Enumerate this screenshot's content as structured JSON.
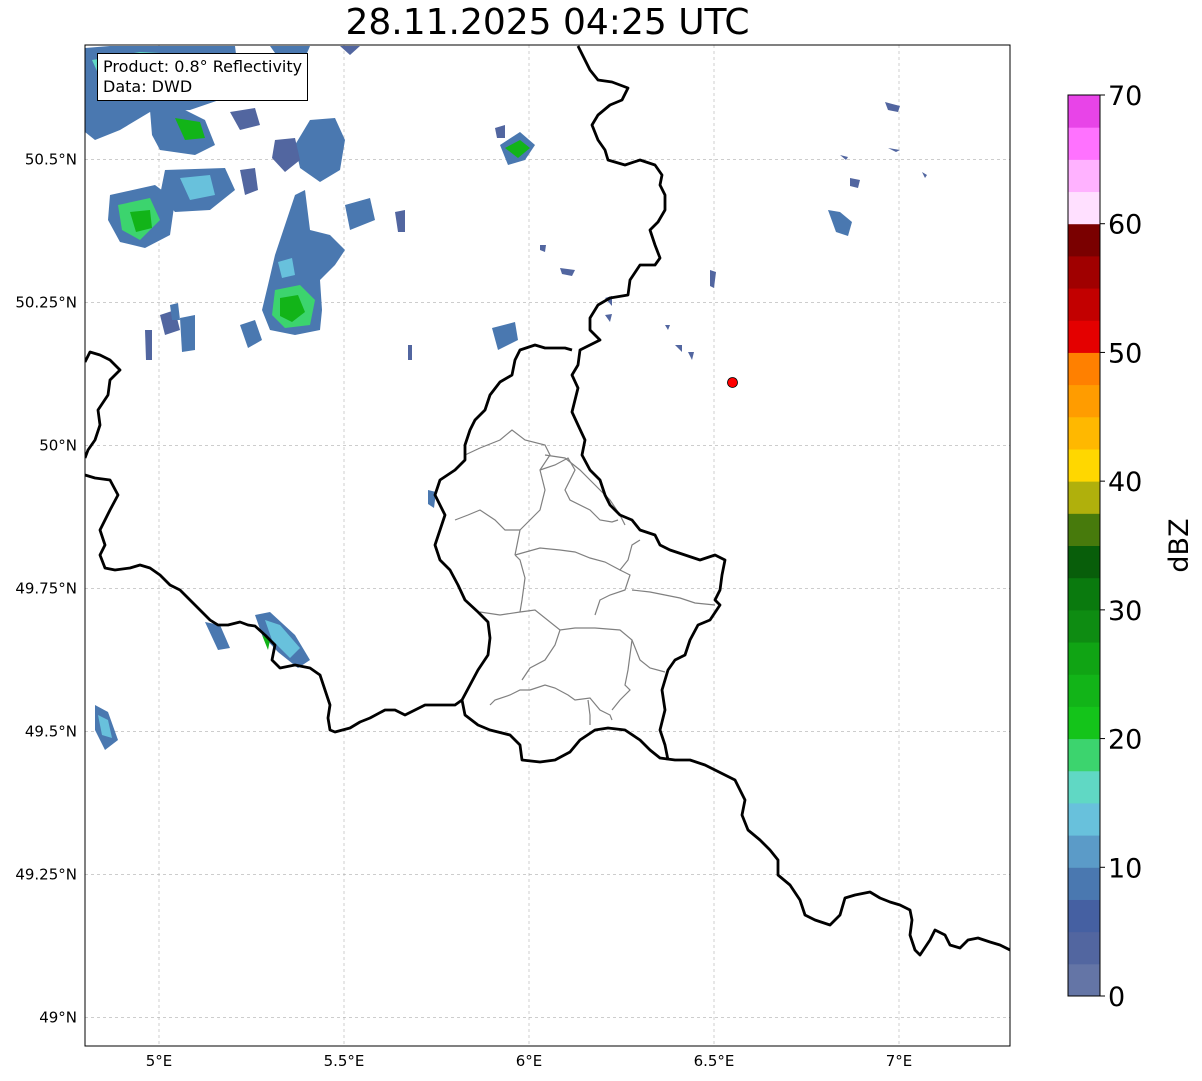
{
  "title": "28.11.2025 04:25 UTC",
  "info": {
    "product": "Product: 0.8° Reflectivity",
    "data": "Data: DWD"
  },
  "axes": {
    "lon_range": [
      4.8,
      7.3
    ],
    "lat_range": [
      48.95,
      50.7
    ],
    "lon_ticks": [
      {
        "value": 5.0,
        "label": "5°E"
      },
      {
        "value": 5.5,
        "label": "5.5°E"
      },
      {
        "value": 6.0,
        "label": "6°E"
      },
      {
        "value": 6.5,
        "label": "6.5°E"
      },
      {
        "value": 7.0,
        "label": "7°E"
      }
    ],
    "lat_ticks": [
      {
        "value": 49.0,
        "label": "49°N"
      },
      {
        "value": 49.25,
        "label": "49.25°N"
      },
      {
        "value": 49.5,
        "label": "49.5°N"
      },
      {
        "value": 49.75,
        "label": "49.75°N"
      },
      {
        "value": 50.0,
        "label": "50°N"
      },
      {
        "value": 50.25,
        "label": "50.25°N"
      },
      {
        "value": 50.5,
        "label": "50.5°N"
      }
    ],
    "gridlines": true
  },
  "marker": {
    "lon": 6.55,
    "lat": 50.11,
    "color": "#ff0000"
  },
  "colorbar": {
    "label": "dBZ",
    "range": [
      0,
      70
    ],
    "ticks": [
      {
        "value": 0,
        "label": "0"
      },
      {
        "value": 10,
        "label": "10"
      },
      {
        "value": 20,
        "label": "20"
      },
      {
        "value": 30,
        "label": "30"
      },
      {
        "value": 40,
        "label": "40"
      },
      {
        "value": 50,
        "label": "50"
      },
      {
        "value": 60,
        "label": "60"
      },
      {
        "value": 70,
        "label": "70"
      }
    ],
    "colors": [
      "#6475a6",
      "#5266a0",
      "#4560a2",
      "#4a78b0",
      "#5b9bc8",
      "#68c1dc",
      "#60d8c4",
      "#3cd46e",
      "#14c41a",
      "#12b418",
      "#10a414",
      "#0e8c12",
      "#0a7a0e",
      "#085e0a",
      "#477a0c",
      "#b0b00c",
      "#ffd700",
      "#ffb800",
      "#ff9c00",
      "#ff8000",
      "#e40000",
      "#c20000",
      "#a00000",
      "#7a0000",
      "#ffe0ff",
      "#ffb2ff",
      "#ff72ff",
      "#e844e8"
    ]
  },
  "palette": {
    "border": "#000000",
    "admin": "#808080",
    "grid": "#b0b0b0"
  }
}
